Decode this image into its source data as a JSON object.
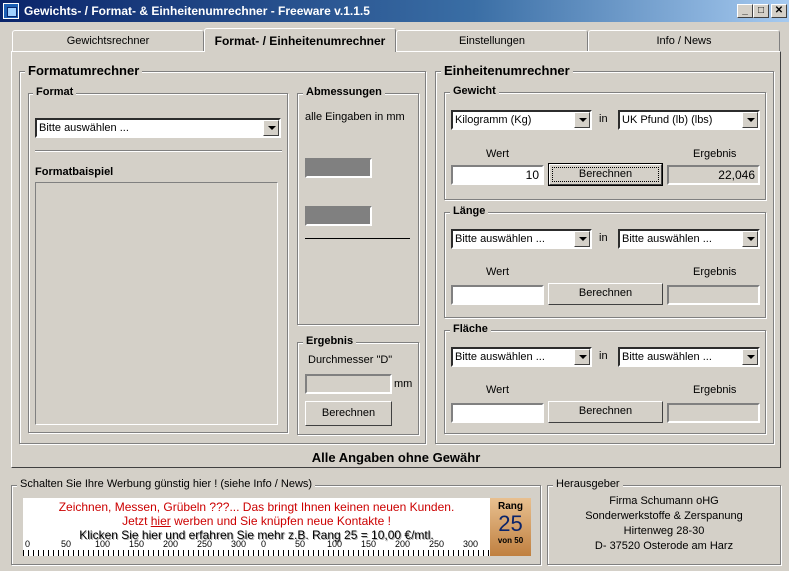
{
  "window": {
    "title": "Gewichts- / Format- & Einheitenumrechner - Freeware v.1.1.5",
    "minimize_glyph": "_",
    "maximize_glyph": "□",
    "close_glyph": "✕"
  },
  "tabs": [
    {
      "label": "Gewichtsrechner"
    },
    {
      "label": "Format- / Einheitenumrechner"
    },
    {
      "label": "Einstellungen"
    },
    {
      "label": "Info / News"
    }
  ],
  "format": {
    "title": "Formatumrechner",
    "format_group": "Format",
    "format_select": "Bitte auswählen ...",
    "example_label": "Formatbaispiel",
    "dim_group": "Abmessungen",
    "dim_note": "alle Eingaben in mm",
    "result_group": "Ergebnis",
    "result_label": "Durchmesser \"D\"",
    "result_unit": "mm",
    "calc_button": "Berechnen"
  },
  "units": {
    "title": "Einheitenumrechner",
    "in_label": "in",
    "wert_label": "Wert",
    "ergebnis_label": "Ergebnis",
    "calc_button": "Berechnen",
    "gewicht": {
      "title": "Gewicht",
      "from": "Kilogramm (Kg)",
      "to": "UK Pfund (lb) (lbs)",
      "value": "10",
      "result": "22,046"
    },
    "laenge": {
      "title": "Länge",
      "from": "Bitte auswählen ...",
      "to": "Bitte auswählen ...",
      "value": "",
      "result": ""
    },
    "flaeche": {
      "title": "Fläche",
      "from": "Bitte auswählen ...",
      "to": "Bitte auswählen ...",
      "value": "",
      "result": ""
    }
  },
  "disclaimer": "Alle Angaben ohne Gewähr",
  "ad": {
    "group": "Schalten Sie Ihre Werbung günstig hier ! (siehe Info / News)",
    "line1": "Zeichnen, Messen, Grübeln ???... Das bringt Ihnen keinen neuen Kunden.",
    "line2_pre": "Jetzt ",
    "line2_link": "hier",
    "line2_post": " werben und Sie knüpfen neue Kontakte !",
    "line3": "Klicken Sie hier und erfahren Sie mehr   z.B. Rang 25 = 10,00 €/mtl.",
    "ruler_labels": [
      "0",
      "50",
      "100",
      "150",
      "200",
      "250",
      "300",
      "0",
      "50",
      "100",
      "150",
      "200",
      "250",
      "300"
    ],
    "rang_label": "Rang",
    "rang_number": "25",
    "rang_of": "von 50",
    "accent": "#cc0000"
  },
  "publisher": {
    "group": "Herausgeber",
    "lines": [
      "Firma Schumann oHG",
      "Sonderwerkstoffe & Zerspanung",
      "Hirtenweg 28-30",
      "D- 37520 Osterode am Harz"
    ]
  }
}
